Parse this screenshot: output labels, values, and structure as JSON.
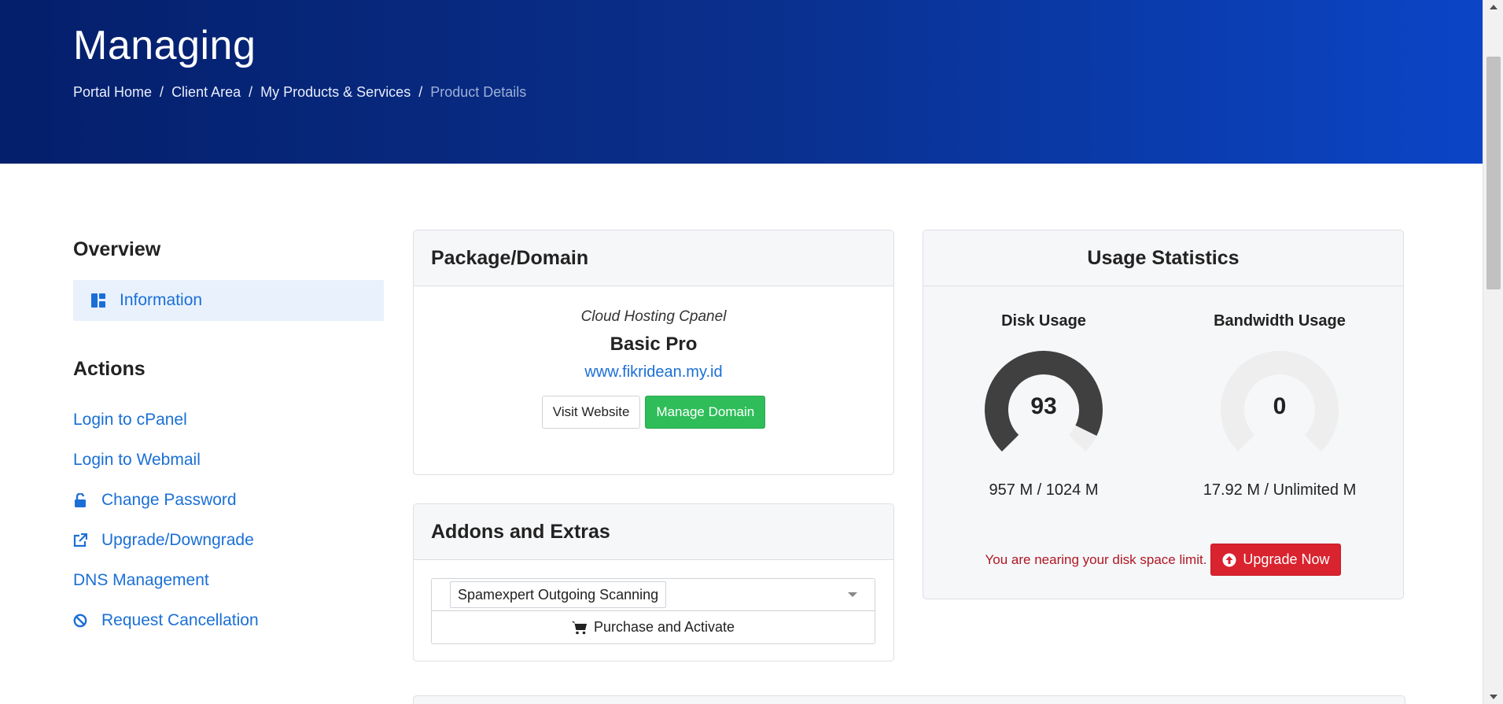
{
  "header": {
    "title": "Managing",
    "breadcrumb": [
      {
        "label": "Portal Home"
      },
      {
        "label": "Client Area"
      },
      {
        "label": "My Products & Services"
      },
      {
        "label": "Product Details"
      }
    ],
    "separator": "/"
  },
  "sidebar": {
    "overview_heading": "Overview",
    "information_label": "Information",
    "actions_heading": "Actions",
    "actions": [
      {
        "label": "Login to cPanel",
        "icon": ""
      },
      {
        "label": "Login to Webmail",
        "icon": ""
      },
      {
        "label": "Change Password",
        "icon": "unlock-icon"
      },
      {
        "label": "Upgrade/Downgrade",
        "icon": "external-link-icon"
      },
      {
        "label": "DNS Management",
        "icon": ""
      },
      {
        "label": "Request Cancellation",
        "icon": "ban-icon"
      }
    ]
  },
  "package": {
    "heading": "Package/Domain",
    "group": "Cloud Hosting Cpanel",
    "name": "Basic Pro",
    "domain": "www.fikridean.my.id",
    "visit_button": "Visit Website",
    "manage_button": "Manage Domain"
  },
  "addons": {
    "heading": "Addons and Extras",
    "selected": "Spamexpert Outgoing Scanning",
    "purchase_button": "Purchase and Activate"
  },
  "usage": {
    "heading": "Usage Statistics",
    "disk": {
      "title": "Disk Usage",
      "percent": 93,
      "value": "957 M / 1024 M"
    },
    "bandwidth": {
      "title": "Bandwidth Usage",
      "percent": 0,
      "value": "17.92 M / Unlimited M"
    },
    "warning": "You are nearing your disk space limit.",
    "upgrade_button": "Upgrade Now"
  },
  "colors": {
    "hero_start": "#041f6b",
    "hero_end": "#0b45c6",
    "link": "#1a6fd6",
    "green": "#2ebd59",
    "red": "#d9232e",
    "gauge_fill": "#404040",
    "gauge_track": "#eeeeee"
  }
}
